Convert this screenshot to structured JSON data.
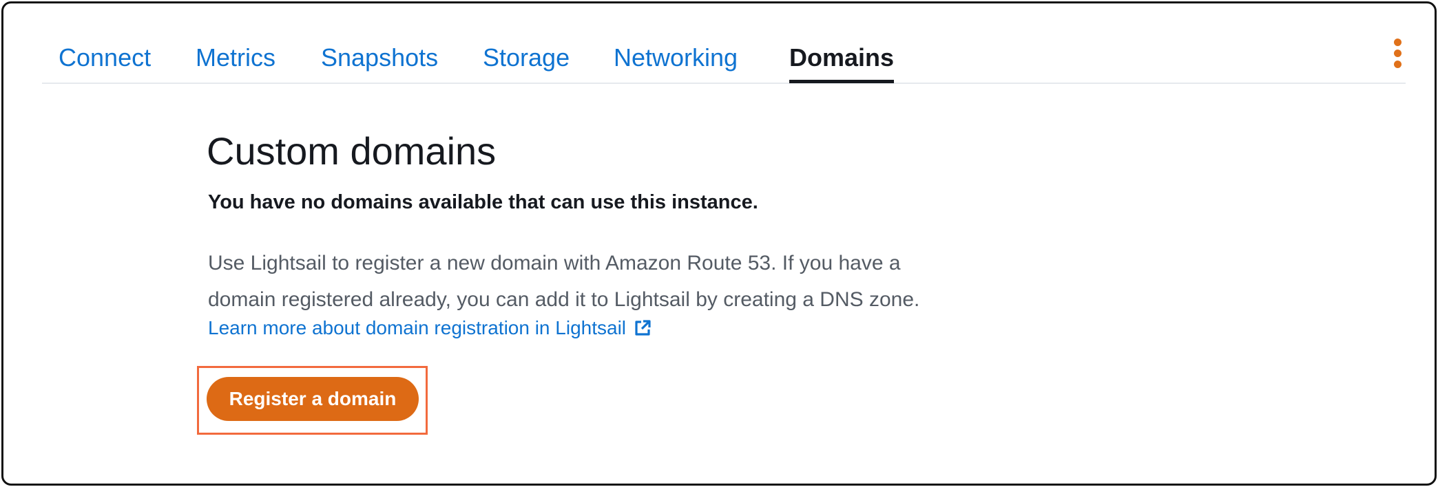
{
  "tabs": [
    {
      "label": "Connect",
      "active": false
    },
    {
      "label": "Metrics",
      "active": false
    },
    {
      "label": "Snapshots",
      "active": false
    },
    {
      "label": "Storage",
      "active": false
    },
    {
      "label": "Networking",
      "active": false
    },
    {
      "label": "Domains",
      "active": true
    }
  ],
  "menu": {
    "icon": "kebab-menu-icon"
  },
  "content": {
    "heading": "Custom domains",
    "subheading": "You have no domains available that can use this instance.",
    "description_line1": "Use Lightsail to register a new domain with Amazon Route 53. If you have a",
    "description_line2": "domain registered already, you can add it to Lightsail by creating a DNS zone.",
    "learn_more_link": "Learn more about domain registration in Lightsail",
    "learn_more_icon": "external-link-icon",
    "register_button": "Register a domain"
  },
  "colors": {
    "link": "#0f73d1",
    "accent": "#dd6a15",
    "highlight": "#f26a3d",
    "text": "#16191f",
    "muted_text": "#545b64"
  }
}
